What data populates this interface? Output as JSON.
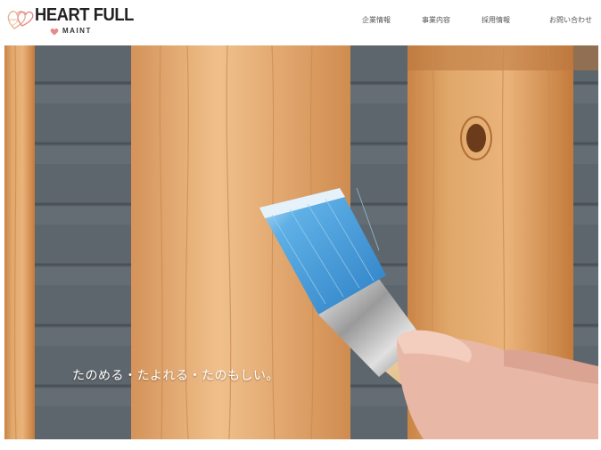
{
  "brand": {
    "title": "HEART FULL",
    "subtitle": "MAINT",
    "colors": {
      "heart": "#e98a8a",
      "heart_outline": "#e8b38f",
      "text": "#222222"
    }
  },
  "nav": {
    "items": [
      {
        "label": "企業情報"
      },
      {
        "label": "事業内容"
      },
      {
        "label": "採用情報"
      },
      {
        "label": "お問い合わせ"
      }
    ]
  },
  "hero": {
    "image": "painting-wood-fence-photo",
    "tagline": "たのめる・たよれる・たのもしい。",
    "colors": {
      "wood": "#d99a5c",
      "brush_bristles": "#3f9ad8",
      "background_siding": "#5b6269"
    }
  }
}
